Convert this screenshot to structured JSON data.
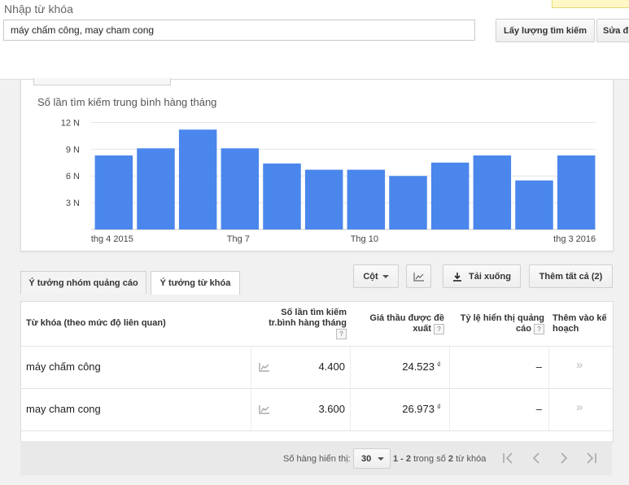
{
  "search": {
    "label": "Nhập từ khóa",
    "value": "máy chấm công, may cham cong",
    "get_volume_button": "Lấy lượng tìm kiếm",
    "edit_button": "Sửa đ"
  },
  "chart_data": {
    "type": "bar",
    "title": "Số lần tìm kiếm trung bình hàng tháng",
    "categories": [
      "thg 4 2015",
      "",
      "",
      "Thg 7",
      "",
      "",
      "Thg 10",
      "",
      "",
      "",
      "",
      "thg 3 2016"
    ],
    "values": [
      8.3,
      9.1,
      11.2,
      9.1,
      7.4,
      6.7,
      6.7,
      6.0,
      7.5,
      8.3,
      5.5,
      8.3
    ],
    "y_ticks": [
      "3 N",
      "6 N",
      "9 N",
      "12 N"
    ],
    "ylim": [
      0,
      12.5
    ],
    "grid": true,
    "color": "#4a86ec"
  },
  "tabs": [
    {
      "label": "Ý tưởng nhóm quảng cáo"
    },
    {
      "label": "Ý tưởng từ khóa"
    }
  ],
  "toolbar": {
    "column_label": "Cột",
    "download_label": "Tải xuống",
    "add_all_label": "Thêm tất cả (2)"
  },
  "table": {
    "headers": {
      "keyword": "Từ khóa (theo mức độ liên quan)",
      "volume_line1": "Số lần tìm kiếm",
      "volume_line2": "tr.bình hàng tháng",
      "bid_line1": "Giá thầu được đề",
      "bid_line2": "xuất",
      "share_line1": "Tỷ lệ hiển thị quảng",
      "share_line2": "cáo",
      "add_line1": "Thêm vào kế",
      "add_line2": "hoạch"
    },
    "help_glyph": "?",
    "rows": [
      {
        "keyword": "máy chấm công",
        "volume": "4.400",
        "bid": "24.523",
        "currency": "₫",
        "share": "–",
        "add": "»"
      },
      {
        "keyword": "may cham cong",
        "volume": "3.600",
        "bid": "26.973",
        "currency": "₫",
        "share": "–",
        "add": "»"
      }
    ]
  },
  "pagination": {
    "rows_label": "Số hàng hiển thị:",
    "rows_value": "30",
    "range": "1 - 2",
    "of_text": "trong số",
    "total": "2",
    "unit": "từ khóa"
  },
  "icons": [
    "line-chart-icon",
    "download-icon",
    "dropdown-arrow-icon",
    "first-page-icon",
    "prev-page-icon",
    "next-page-icon",
    "last-page-icon",
    "add-to-plan-icon"
  ]
}
